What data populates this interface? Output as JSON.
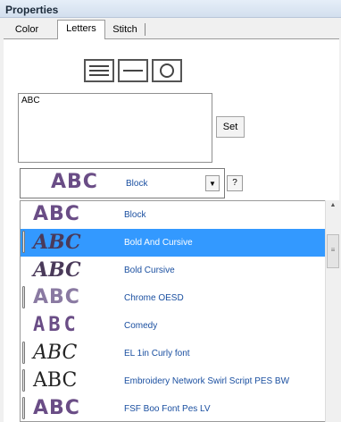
{
  "window": {
    "title": "Properties"
  },
  "tabs": [
    {
      "label": "Color"
    },
    {
      "label": "Letters"
    },
    {
      "label": "Stitch"
    }
  ],
  "shape_buttons": [
    {
      "icon": "multi-line-icon"
    },
    {
      "icon": "single-line-icon"
    },
    {
      "icon": "circle-icon"
    }
  ],
  "text_input": {
    "value": "ABC"
  },
  "set_button": {
    "label": "Set"
  },
  "font_combo": {
    "preview": "ABC",
    "selected_label": "Block",
    "arrow": "▼"
  },
  "help_button": {
    "label": "?"
  },
  "font_list": {
    "items": [
      {
        "preview": "ABC",
        "label": "Block",
        "selected": false,
        "needle": false
      },
      {
        "preview": "ABC",
        "label": "Bold And Cursive",
        "selected": true,
        "needle": true
      },
      {
        "preview": "ABC",
        "label": "Bold Cursive",
        "selected": false,
        "needle": false
      },
      {
        "preview": "ABC",
        "label": "Chrome OESD",
        "selected": false,
        "needle": true
      },
      {
        "preview": "ABC",
        "label": "Comedy",
        "selected": false,
        "needle": false
      },
      {
        "preview": "ABC",
        "label": "EL 1in Curly font",
        "selected": false,
        "needle": true
      },
      {
        "preview": "ABC",
        "label": "Embroidery Network Swirl Script PES BW",
        "selected": false,
        "needle": true
      },
      {
        "preview": "ABC",
        "label": "FSF Boo Font Pes LV",
        "selected": false,
        "needle": true
      }
    ]
  },
  "scrollbar": {
    "up_arrow": "▲",
    "thumb_grip": "≡"
  },
  "colors": {
    "selection": "#3399ff",
    "preview_purple": "#6a4d86",
    "label_blue": "#1a4fa0"
  }
}
